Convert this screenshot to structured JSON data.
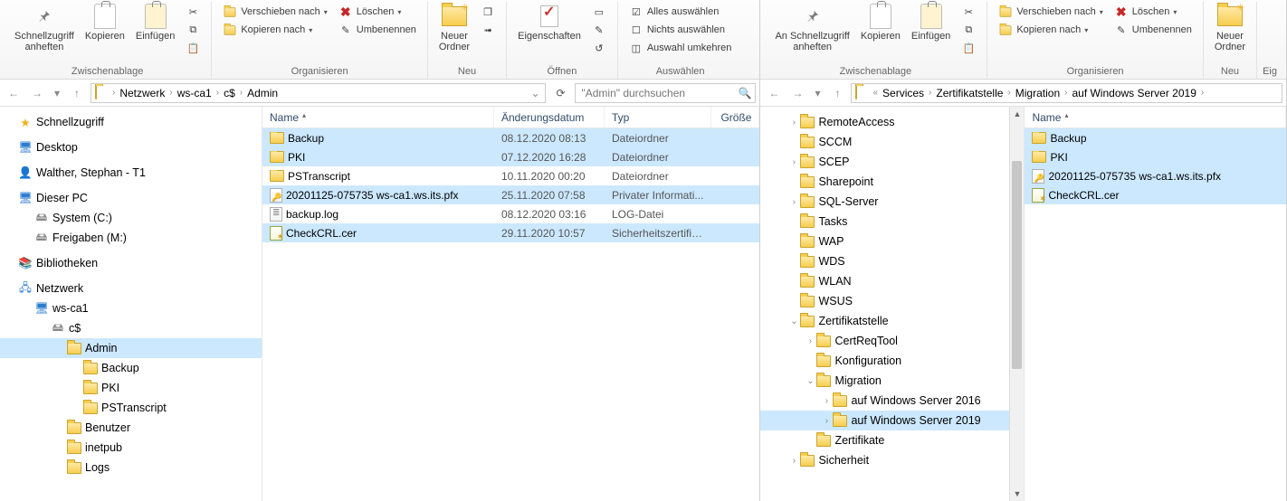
{
  "ribbon": {
    "groups": {
      "clipboard": {
        "label": "Zwischenablage",
        "pin_label": "An Schnellzugriff\nanheften",
        "pin_label_left": "Schnellzugriff\nanheften",
        "copy": "Kopieren",
        "paste": "Einfügen"
      },
      "organize": {
        "label": "Organisieren",
        "move_to": "Verschieben nach",
        "copy_to": "Kopieren nach",
        "delete": "Löschen",
        "rename": "Umbenennen"
      },
      "new": {
        "label": "Neu",
        "new_folder": "Neuer\nOrdner"
      },
      "open": {
        "label": "Öffnen",
        "properties": "Eigenschaften"
      },
      "open_right": {
        "label": "Neu"
      },
      "select": {
        "label": "Auswählen",
        "select_all": "Alles auswählen",
        "select_none": "Nichts auswählen",
        "invert": "Auswahl umkehren"
      },
      "right_extra_label": "Eig"
    }
  },
  "left": {
    "breadcrumbs": [
      "Netzwerk",
      "ws-ca1",
      "c$",
      "Admin"
    ],
    "search_placeholder": "\"Admin\" durchsuchen",
    "columns": {
      "name": "Name",
      "date": "Änderungsdatum",
      "type": "Typ",
      "size": "Größe"
    },
    "tree": [
      {
        "indent": 0,
        "icon": "star",
        "label": "Schnellzugriff"
      },
      {
        "indent": 0,
        "icon": "desktop",
        "label": "Desktop"
      },
      {
        "indent": 0,
        "icon": "user",
        "label": "Walther, Stephan - T1"
      },
      {
        "indent": 0,
        "icon": "pc",
        "label": "Dieser PC"
      },
      {
        "indent": 1,
        "icon": "drive",
        "label": "System (C:)"
      },
      {
        "indent": 1,
        "icon": "netdrive",
        "label": "Freigaben (M:)"
      },
      {
        "indent": 0,
        "icon": "lib",
        "label": "Bibliotheken"
      },
      {
        "indent": 0,
        "icon": "net",
        "label": "Netzwerk"
      },
      {
        "indent": 1,
        "icon": "pc",
        "label": "ws-ca1"
      },
      {
        "indent": 2,
        "icon": "share",
        "label": "c$"
      },
      {
        "indent": 3,
        "icon": "folder",
        "label": "Admin",
        "active": true
      },
      {
        "indent": 4,
        "icon": "folder",
        "label": "Backup"
      },
      {
        "indent": 4,
        "icon": "folder",
        "label": "PKI"
      },
      {
        "indent": 4,
        "icon": "folder",
        "label": "PSTranscript"
      },
      {
        "indent": 3,
        "icon": "folder",
        "label": "Benutzer"
      },
      {
        "indent": 3,
        "icon": "folder",
        "label": "inetpub"
      },
      {
        "indent": 3,
        "icon": "folder",
        "label": "Logs"
      }
    ],
    "rows": [
      {
        "sel": true,
        "icon": "folder",
        "name": "Backup",
        "date": "08.12.2020 08:13",
        "type": "Dateiordner",
        "size": ""
      },
      {
        "sel": true,
        "icon": "folder",
        "name": "PKI",
        "date": "07.12.2020 16:28",
        "type": "Dateiordner",
        "size": ""
      },
      {
        "sel": false,
        "icon": "folder",
        "name": "PSTranscript",
        "date": "10.11.2020 00:20",
        "type": "Dateiordner",
        "size": ""
      },
      {
        "sel": true,
        "icon": "pfx",
        "name": "20201125-075735 ws-ca1.ws.its.pfx",
        "date": "25.11.2020 07:58",
        "type": "Privater Informati...",
        "size": ""
      },
      {
        "sel": false,
        "icon": "log",
        "name": "backup.log",
        "date": "08.12.2020 03:16",
        "type": "LOG-Datei",
        "size": ""
      },
      {
        "sel": true,
        "icon": "cert",
        "name": "CheckCRL.cer",
        "date": "29.11.2020 10:57",
        "type": "Sicherheitszertifikat",
        "size": ""
      }
    ]
  },
  "right": {
    "breadcrumbs": [
      "Services",
      "Zertifikatstelle",
      "Migration",
      "auf Windows Server 2019"
    ],
    "breadcrumb_prefix": "«",
    "columns": {
      "name": "Name"
    },
    "tree": [
      {
        "indent": 0,
        "exp": ">",
        "icon": "folder",
        "label": "RemoteAccess"
      },
      {
        "indent": 0,
        "exp": "",
        "icon": "folder",
        "label": "SCCM"
      },
      {
        "indent": 0,
        "exp": ">",
        "icon": "folder",
        "label": "SCEP"
      },
      {
        "indent": 0,
        "exp": "",
        "icon": "folder",
        "label": "Sharepoint"
      },
      {
        "indent": 0,
        "exp": ">",
        "icon": "folder",
        "label": "SQL-Server"
      },
      {
        "indent": 0,
        "exp": "",
        "icon": "folder",
        "label": "Tasks"
      },
      {
        "indent": 0,
        "exp": "",
        "icon": "folder",
        "label": "WAP"
      },
      {
        "indent": 0,
        "exp": "",
        "icon": "folder",
        "label": "WDS"
      },
      {
        "indent": 0,
        "exp": "",
        "icon": "folder",
        "label": "WLAN"
      },
      {
        "indent": 0,
        "exp": "",
        "icon": "folder",
        "label": "WSUS"
      },
      {
        "indent": 0,
        "exp": "v",
        "icon": "folder",
        "label": "Zertifikatstelle"
      },
      {
        "indent": 1,
        "exp": ">",
        "icon": "folder",
        "label": "CertReqTool"
      },
      {
        "indent": 1,
        "exp": "",
        "icon": "folder",
        "label": "Konfiguration"
      },
      {
        "indent": 1,
        "exp": "v",
        "icon": "folder",
        "label": "Migration"
      },
      {
        "indent": 2,
        "exp": ">",
        "icon": "folder",
        "label": "auf Windows Server 2016"
      },
      {
        "indent": 2,
        "exp": ">",
        "icon": "folder",
        "label": "auf Windows Server 2019",
        "active": true
      },
      {
        "indent": 1,
        "exp": "",
        "icon": "folder",
        "label": "Zertifikate"
      },
      {
        "indent": 0,
        "exp": ">",
        "icon": "folder",
        "label": "Sicherheit"
      }
    ],
    "rows": [
      {
        "sel": true,
        "icon": "folder",
        "name": "Backup"
      },
      {
        "sel": true,
        "icon": "folder",
        "name": "PKI"
      },
      {
        "sel": true,
        "icon": "pfx",
        "name": "20201125-075735 ws-ca1.ws.its.pfx"
      },
      {
        "sel": true,
        "icon": "cert",
        "name": "CheckCRL.cer"
      }
    ]
  }
}
